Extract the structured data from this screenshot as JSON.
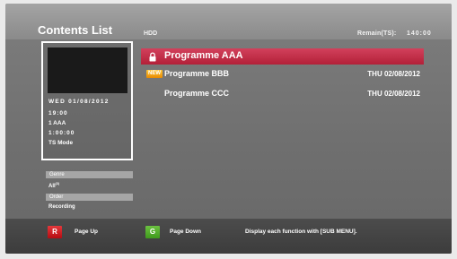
{
  "header": {
    "title": "Contents List",
    "source": "HDD",
    "remain_label": "Remain(TS):",
    "remain_value": "140:00"
  },
  "info_panel": {
    "date": "WED 01/08/2012",
    "time": "19:00",
    "channel": "1 AAA",
    "duration": "1:00:00",
    "mode": "TS Mode"
  },
  "programmes": [
    {
      "name": "Programme AAA",
      "date": "",
      "icon": "lock-icon",
      "selected": true
    },
    {
      "name": "Programme BBB",
      "date": "THU 02/08/2012",
      "icon": "new-badge",
      "badge_text": "NEW",
      "selected": false
    },
    {
      "name": "Programme CCC",
      "date": "THU 02/08/2012",
      "icon": "",
      "selected": false
    }
  ],
  "filters": {
    "genre_label": "Genre",
    "genre_value": "All",
    "genre_sup": "(3)",
    "order_label": "Order",
    "order_value": "Recording"
  },
  "footer": {
    "red_key": "R",
    "red_label": "Page Up",
    "green_key": "G",
    "green_label": "Page Down",
    "help_text": "Display each function with [SUB MENU]."
  },
  "colors": {
    "selected_row": "#c2304b",
    "red_key": "#d01f25",
    "green_key": "#55ae2e",
    "new_badge": "#f0a010"
  }
}
